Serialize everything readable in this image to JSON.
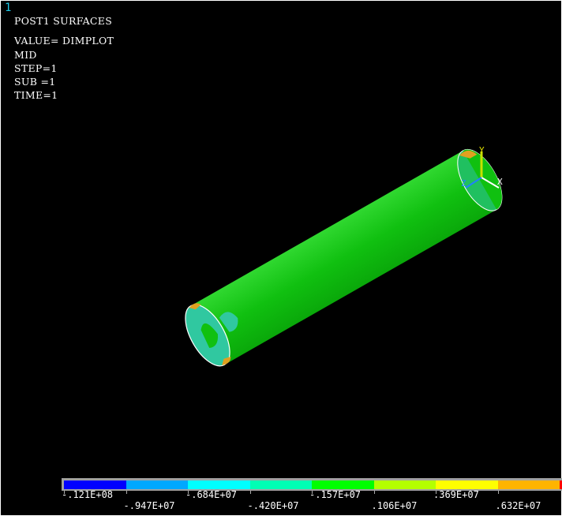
{
  "window_number": "1",
  "header": {
    "title": "POST1 SURFACES",
    "lines": [
      "VALUE= DIMPLOT",
      "MID",
      "STEP=1",
      "SUB =1",
      "TIME=1"
    ]
  },
  "triad": {
    "x_label": "X",
    "y_label": "Y",
    "z_label": "Z"
  },
  "legend": {
    "colors": [
      "#0000ff",
      "#00a8ff",
      "#00ffff",
      "#00ffb4",
      "#00ff00",
      "#b4ff00",
      "#ffff00",
      "#ffb400",
      "#ff0000"
    ],
    "labels": [
      "-.121E+08",
      "-.947E+07",
      "-.684E+07",
      "-.420E+07",
      "-.157E+07",
      ".106E+07",
      ".369E+07",
      ".632E+07"
    ]
  },
  "colors": {
    "background": "#000000",
    "body": "#10c010",
    "end_cap": "#30c8a0",
    "text": "#ffffff",
    "window_number": "#1ec8e6"
  }
}
